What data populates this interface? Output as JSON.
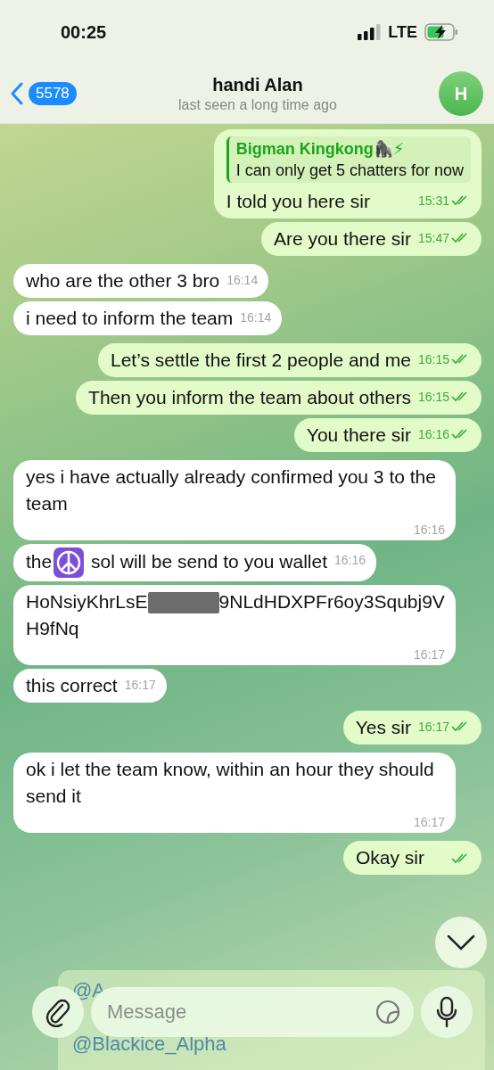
{
  "status_bar": {
    "time": "00:25",
    "network": "LTE"
  },
  "header": {
    "back_count": "5578",
    "title": "handi Alan",
    "subtitle": "last seen a long time ago",
    "avatar_letter": "H"
  },
  "messages": [
    {
      "kind": "quote_reply",
      "outgoing": true,
      "quote_author": "Bigman Kingkong🦍⚡",
      "quote_text": "I can only get 5 chatters for now",
      "text": "I told you here sir",
      "time": "15:31",
      "read": true
    },
    {
      "kind": "text",
      "outgoing": true,
      "text": "Are you there sir",
      "time": "15:47",
      "read": true
    },
    {
      "kind": "text",
      "outgoing": false,
      "text": "who are the other 3 bro",
      "time": "16:14"
    },
    {
      "kind": "text",
      "outgoing": false,
      "text": "i need to inform the team",
      "time": "16:14"
    },
    {
      "kind": "text",
      "outgoing": true,
      "text": "Let’s settle the first 2 people and me",
      "time": "16:15",
      "read": true
    },
    {
      "kind": "text",
      "outgoing": true,
      "text": "Then you inform the team about others",
      "time": "16:15",
      "read": true
    },
    {
      "kind": "text",
      "outgoing": true,
      "text": "You there sir",
      "time": "16:16",
      "read": true
    },
    {
      "kind": "text",
      "outgoing": false,
      "text": "yes i have actually already confirmed you 3 to the team",
      "time": "16:16"
    },
    {
      "kind": "emoji_text",
      "outgoing": false,
      "before": "the",
      "text": "sol will be send to you wallet",
      "time": "16:16"
    },
    {
      "kind": "redacted",
      "outgoing": false,
      "before": "HoNsiyKhrLsE",
      "text": "9NLdHDXPFr6oy3Squbj9VH9fNq",
      "time": "16:17"
    },
    {
      "kind": "text",
      "outgoing": false,
      "text": "this correct",
      "time": "16:17"
    },
    {
      "kind": "text",
      "outgoing": true,
      "text": "Yes sir",
      "time": "16:17",
      "read": true
    },
    {
      "kind": "text",
      "outgoing": false,
      "text": "ok i let the team know, within an hour they should send it",
      "time": "16:17"
    },
    {
      "kind": "text",
      "outgoing": true,
      "text": "Okay sir",
      "read": true
    }
  ],
  "mentions": [
    "@A",
    "@Blackice_Alpha"
  ],
  "composer": {
    "placeholder": "Message"
  }
}
